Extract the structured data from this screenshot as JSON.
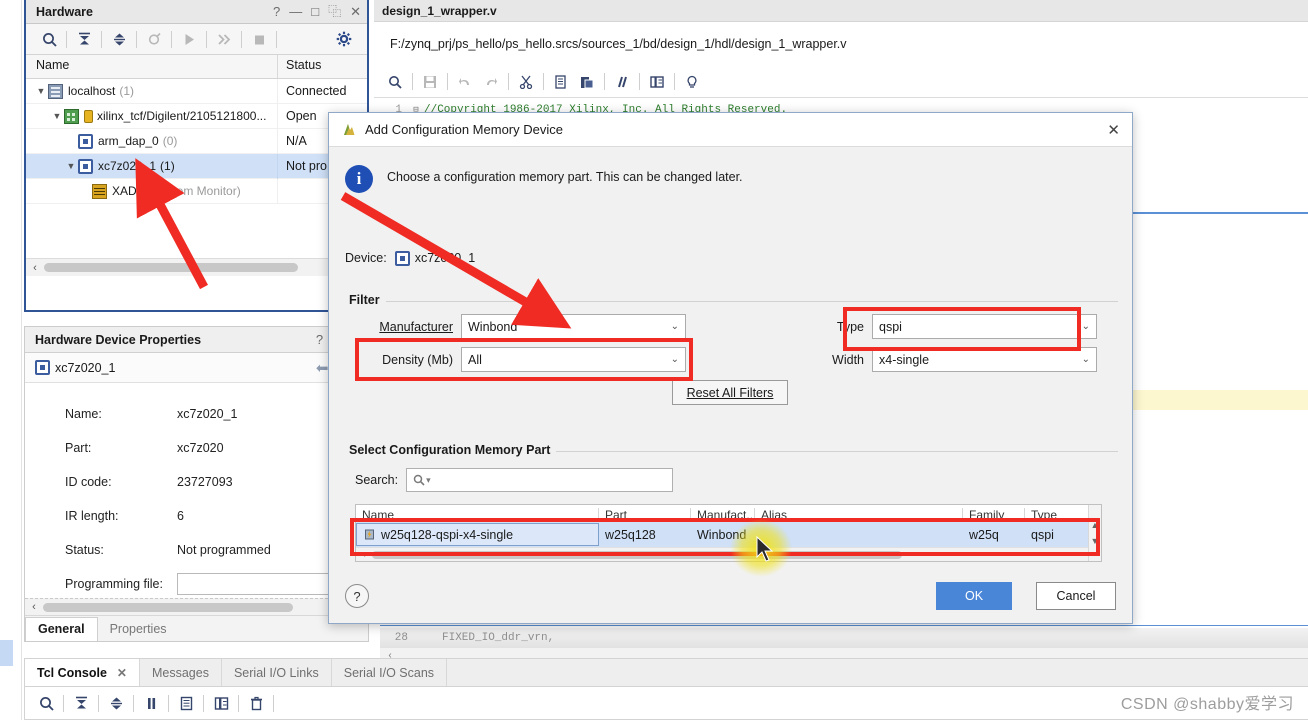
{
  "hardware_panel": {
    "title": "Hardware",
    "window_buttons": [
      "?",
      "—",
      "□",
      "⿻",
      "✕"
    ],
    "toolbar_icons": [
      "search-icon",
      "collapse-all-icon",
      "expand-all-icon",
      "refresh-icon",
      "run-icon",
      "step-icon",
      "stop-icon",
      "settings-gear-icon"
    ],
    "columns": [
      "Name",
      "Status"
    ],
    "rows": [
      {
        "name": "localhost",
        "count": "(1)",
        "status": "Connected",
        "icon": "server-icon",
        "indent": 0,
        "expanded": true,
        "selected": false
      },
      {
        "name": "xilinx_tcf/Digilent/2105121800...",
        "count": "",
        "status": "Open",
        "icon": "board-icon",
        "indent": 1,
        "expanded": true,
        "selected": false
      },
      {
        "name": "arm_dap_0",
        "count": "(0)",
        "status": "N/A",
        "icon": "chip-icon",
        "indent": 2,
        "expanded": false,
        "selected": false
      },
      {
        "name": "xc7z020_1",
        "count": "(1)",
        "status": "Not pro",
        "icon": "chip-icon",
        "indent": 2,
        "expanded": true,
        "selected": true
      },
      {
        "name": "XADC",
        "count": "(System Monitor)",
        "status": "",
        "icon": "xadc-icon",
        "indent": 3,
        "expanded": false,
        "selected": false
      }
    ]
  },
  "device_properties": {
    "title": "Hardware Device Properties",
    "window_buttons": [
      "?",
      "—",
      "□"
    ],
    "subject": "xc7z020_1",
    "nav": [
      "back-arrow-icon",
      "forward-arrow-icon"
    ],
    "fields": [
      {
        "label": "Name:",
        "value": "xc7z020_1"
      },
      {
        "label": "Part:",
        "value": "xc7z020"
      },
      {
        "label": "ID code:",
        "value": "23727093"
      },
      {
        "label": "IR length:",
        "value": "6"
      },
      {
        "label": "Status:",
        "value": "Not programmed"
      }
    ],
    "programming_file": {
      "label": "Programming file:",
      "value": ""
    },
    "tabs": [
      {
        "label": "General",
        "active": true
      },
      {
        "label": "Properties",
        "active": false
      }
    ]
  },
  "console": {
    "tabs": [
      {
        "label": "Tcl Console",
        "active": true,
        "closable": true
      },
      {
        "label": "Messages",
        "active": false,
        "closable": false
      },
      {
        "label": "Serial I/O Links",
        "active": false,
        "closable": false
      },
      {
        "label": "Serial I/O Scans",
        "active": false,
        "closable": false
      }
    ],
    "toolbar_icons": [
      "search-icon",
      "collapse-all-icon",
      "expand-all-icon",
      "pause-icon",
      "copy-icon",
      "columns-icon",
      "trash-icon"
    ]
  },
  "editor": {
    "tab_name": "design_1_wrapper.v",
    "file_path": "F:/zynq_prj/ps_hello/ps_hello.srcs/sources_1/bd/design_1/hdl/design_1_wrapper.v",
    "toolbar_icons": [
      "search-icon",
      "save-icon",
      "undo-icon",
      "redo-icon",
      "cut-icon",
      "copy-icon",
      "paste-icon",
      "comment-icon",
      "indent-icon",
      "bulb-icon"
    ],
    "lines": [
      {
        "number": "1",
        "text": "//Copyright 1986-2017 Xilinx, Inc. All Rights Reserved."
      }
    ],
    "last_line": {
      "number": "28",
      "text": "FIXED_IO_ddr_vrn,"
    }
  },
  "dialog": {
    "title": "Add Configuration Memory Device",
    "close_icon": "close-icon",
    "info_text": "Choose a configuration memory part. This can be changed later.",
    "device_label": "Device:",
    "device_value": "xc7z020_1",
    "filter": {
      "group_label": "Filter",
      "manufacturer": {
        "label": "Manufacturer",
        "value": "Winbond"
      },
      "density": {
        "label": "Density (Mb)",
        "value": "All"
      },
      "type": {
        "label": "Type",
        "value": "qspi"
      },
      "width": {
        "label": "Width",
        "value": "x4-single"
      },
      "reset_button": "Reset All Filters"
    },
    "select_part": {
      "group_label": "Select Configuration Memory Part",
      "search_label": "Search:",
      "search_value": "",
      "search_icon": "search-icon",
      "columns": [
        "Name",
        "Part",
        "Manufact...",
        "Alias",
        "Family",
        "Type"
      ],
      "rows": [
        {
          "name": "w25q128-qspi-x4-single",
          "part": "w25q128",
          "manufacturer": "Winbond",
          "alias": "",
          "family": "w25q",
          "type": "qspi",
          "selected": true,
          "icon": "memory-chip-icon"
        }
      ]
    },
    "footer": {
      "help": "?",
      "ok": "OK",
      "cancel": "Cancel"
    }
  },
  "watermark": "CSDN @shabby爱学习",
  "colors": {
    "accent_blue": "#4a86d8",
    "selection_blue": "#cfe0f7",
    "panel_border_blue": "#2f5597",
    "annotation_red": "#ef2b23",
    "highlight_yellow": "#f0e114",
    "info_blue": "#1f4fb5"
  }
}
